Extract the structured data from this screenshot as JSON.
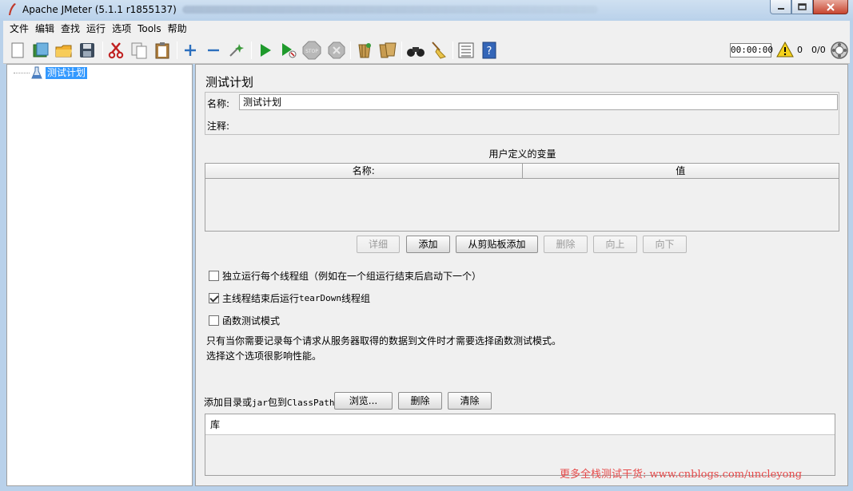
{
  "window": {
    "title": "Apache JMeter (5.1.1 r1855137)"
  },
  "menu": [
    "文件",
    "编辑",
    "查找",
    "运行",
    "选项",
    "Tools",
    "帮助"
  ],
  "toolbar": {
    "timer": "00:00:00",
    "error_count": "0",
    "thread_count": "0/0"
  },
  "tree": {
    "root_label": "测试计划"
  },
  "panel": {
    "title": "测试计划",
    "name_label": "名称:",
    "name_value": "测试计划",
    "comment_label": "注释:",
    "comment_value": "",
    "vars_title": "用户定义的变量",
    "columns": [
      "名称:",
      "值"
    ],
    "buttons": {
      "detail": "详细",
      "add": "添加",
      "add_clipboard": "从剪贴板添加",
      "delete": "删除",
      "up": "向上",
      "down": "向下"
    },
    "checks": [
      {
        "label": "独立运行每个线程组（例如在一个组运行结束后启动下一个）",
        "checked": false
      },
      {
        "label_prefix": "主线程结束后运行 ",
        "label_mono": "tearDown",
        "label_suffix": "线程组",
        "checked": true
      },
      {
        "label": "函数测试模式",
        "checked": false
      }
    ],
    "info_line1": "只有当你需要记录每个请求从服务器取得的数据到文件时才需要选择函数测试模式。",
    "info_line2": "选择这个选项很影响性能。",
    "classpath_label_prefix": "添加目录或",
    "classpath_label_mono1": "jar",
    "classpath_label_mid": "包到",
    "classpath_label_mono2": "ClassPath",
    "browse": "浏览...",
    "cp_delete": "删除",
    "cp_clear": "清除",
    "lib_header": "库"
  },
  "watermark": "更多全栈测试干货: www.cnblogs.com/uncleyong"
}
